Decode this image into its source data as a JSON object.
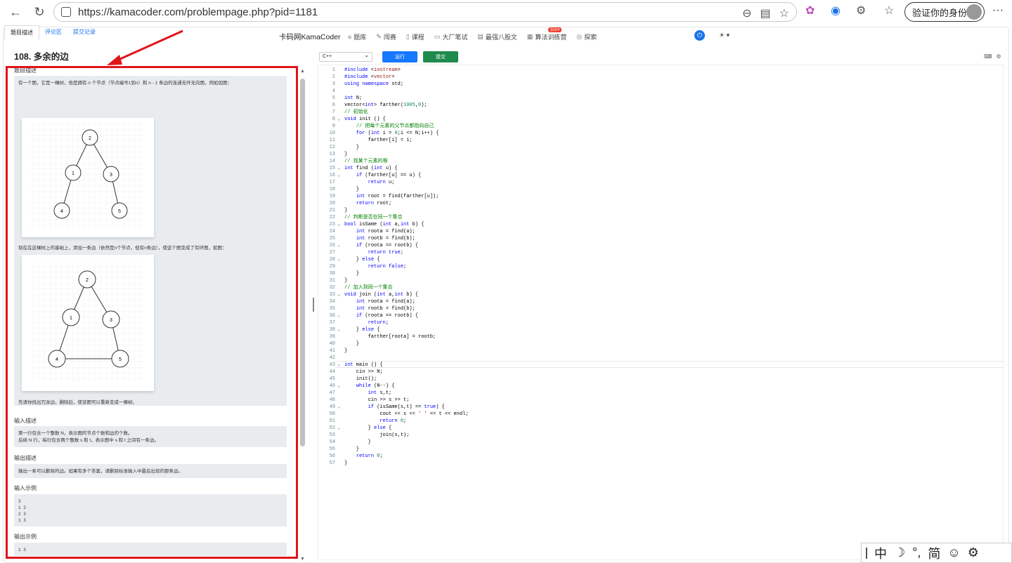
{
  "browser": {
    "url": "https://kamacoder.com/problempage.php?pid=1181",
    "profile_label": "验证你的身份"
  },
  "site_nav": {
    "brand": "卡码网KamaCoder",
    "items": [
      {
        "icon": "list-icon",
        "label": "题库"
      },
      {
        "icon": "pen-icon",
        "label": "闯赛"
      },
      {
        "icon": "book-icon",
        "label": "课程"
      },
      {
        "icon": "file-icon",
        "label": "大厂笔试"
      },
      {
        "icon": "doc-icon",
        "label": "最强八股文"
      },
      {
        "icon": "calendar-icon",
        "label": "算法训练营"
      },
      {
        "icon": "compass-icon",
        "label": "探索"
      }
    ],
    "hot_badge": "算法训练营"
  },
  "left": {
    "tabs": [
      "题目描述",
      "评论区",
      "提交记录"
    ],
    "problem_title": "108. 多余的边",
    "desc_label": "题目描述",
    "desc_text_1": "有一个图，它是一棵树，他是拥有 n 个节点（节点编号1到n）和 n - 1 条边的连通无环无向图，例如如图：",
    "desc_text_2": "现在在这棵树上的基础上，添加一条边（依然是n个节点，但有n条边），使这个图变成了有环图，如图：",
    "desc_text_3": "先请你找出冗余边，删除后，使该图可以重新变成一棵树。",
    "tree_nodes": [
      "2",
      "1",
      "3",
      "4",
      "5"
    ],
    "input_label": "输入描述",
    "input_text_1": "第一行包含一个整数 N，表示图的节点个数和边的个数。",
    "input_text_2": "后续 N 行，每行包含两个整数 s 和 t，表示图中 s 和 t 之间有一条边。",
    "output_label": "输出描述",
    "output_text": "输出一条可以删除的边。如果有多个答案，请删除标准输入中最后出现的那条边。",
    "sample_in_label": "输入示例",
    "sample_in": "3\n1 2\n2 3\n1 3",
    "sample_out_label": "输出示例",
    "sample_out": "1 3"
  },
  "editor": {
    "language": "C++",
    "run_label": "运行",
    "submit_label": "提交",
    "lines": [
      "#include <iostream>",
      "#include <vector>",
      "using namespace std;",
      "",
      "int N;",
      "vector<int> farther(1005,0);",
      "// 初始化",
      "void init () {",
      "    // 把每个元素的父节点都指向自己",
      "    for (int i = 0;i <= N;i++) {",
      "        farther[i] = i;",
      "    }",
      "}",
      "// 找某个元素的根",
      "int find (int u) {",
      "    if (farther[u] == u) {",
      "        return u;",
      "    }",
      "    int root = find(farther[u]);",
      "    return root;",
      "}",
      "// 判断是否在同一个集合",
      "bool isSame (int a,int b) {",
      "    int roota = find(a);",
      "    int rootb = find(b);",
      "    if (roota == rootb) {",
      "        return true;",
      "    } else {",
      "        return false;",
      "    }",
      "}",
      "// 加入到同一个集合",
      "void join (int a,int b) {",
      "    int roota = find(a);",
      "    int rootb = find(b);",
      "    if (roota == rootb) {",
      "        return;",
      "    } else {",
      "        farther[roota] = rootb;",
      "    }",
      "}",
      "",
      "int main () {",
      "    cin >> N;",
      "    init();",
      "    while (N--) {",
      "        int s,t;",
      "        cin >> s >> t;",
      "        if (isSame(s,t) == true) {",
      "            cout << s << ' ' << t << endl;",
      "            return 0;",
      "        } else {",
      "            join(s,t);",
      "        }",
      "    }",
      "    return 0;",
      "}"
    ],
    "fold_lines": [
      8,
      15,
      16,
      23,
      26,
      28,
      33,
      36,
      38,
      43,
      46,
      49,
      52
    ]
  },
  "ime": [
    "中",
    "☽",
    "°,",
    "简",
    "☺",
    "⚙"
  ]
}
